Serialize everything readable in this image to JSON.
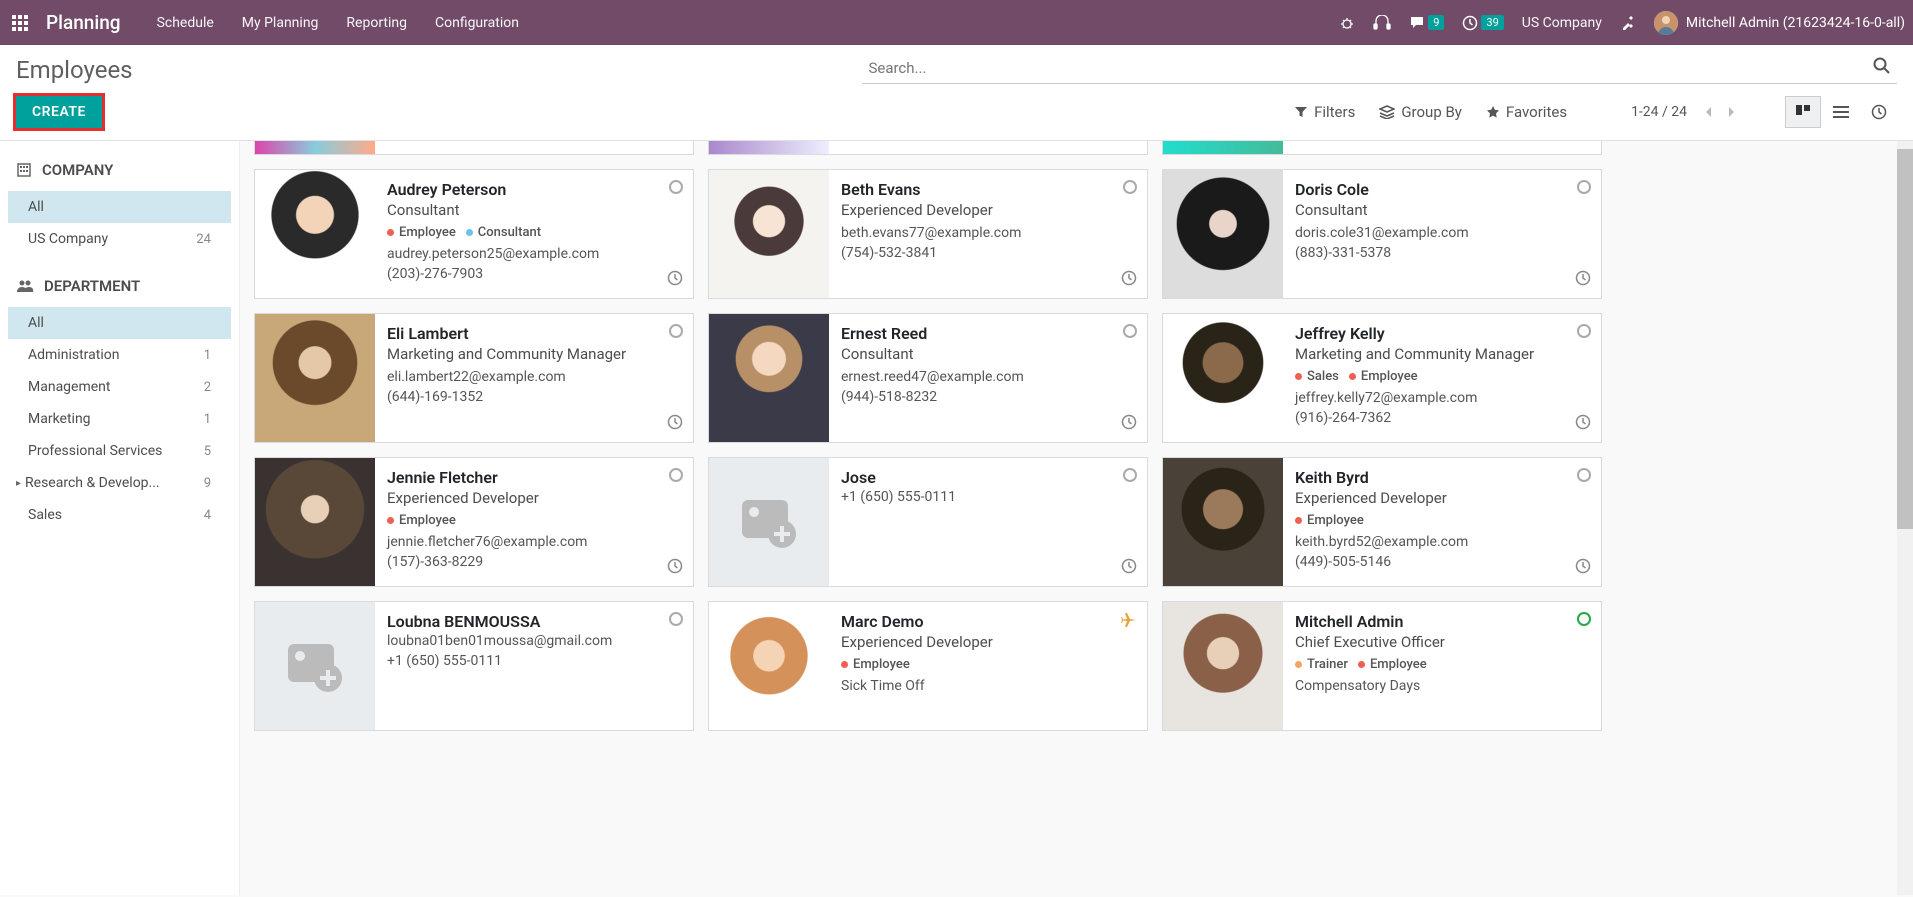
{
  "navbar": {
    "brand": "Planning",
    "menu": [
      "Schedule",
      "My Planning",
      "Reporting",
      "Configuration"
    ],
    "messages_count": "9",
    "activities_count": "39",
    "company": "US Company",
    "user": "Mitchell Admin (21623424-16-0-all)"
  },
  "control": {
    "title": "Employees",
    "create": "CREATE",
    "search_placeholder": "Search...",
    "filters": "Filters",
    "groupby": "Group By",
    "favorites": "Favorites",
    "pager": "1-24 / 24"
  },
  "sidebar": {
    "company_header": "COMPANY",
    "company_items": [
      {
        "label": "All",
        "count": "",
        "selected": true
      },
      {
        "label": "US Company",
        "count": "24"
      }
    ],
    "dept_header": "DEPARTMENT",
    "dept_items": [
      {
        "label": "All",
        "count": "",
        "selected": true
      },
      {
        "label": "Administration",
        "count": "1"
      },
      {
        "label": "Management",
        "count": "2"
      },
      {
        "label": "Marketing",
        "count": "1"
      },
      {
        "label": "Professional Services",
        "count": "5"
      },
      {
        "label": "Research & Develop...",
        "count": "9",
        "arrow": true
      },
      {
        "label": "Sales",
        "count": "4"
      }
    ]
  },
  "cards": [
    [
      {
        "name": "Audrey Peterson",
        "title": "Consultant",
        "tags": [
          {
            "color": "red",
            "label": "Employee"
          },
          {
            "color": "blue",
            "label": "Consultant"
          }
        ],
        "email": "audrey.peterson25@example.com",
        "phone": "(203)-276-7903",
        "img": "ph-audrey",
        "activity": true
      },
      {
        "name": "Beth Evans",
        "title": "Experienced Developer",
        "email": "beth.evans77@example.com",
        "phone": "(754)-532-3841",
        "img": "ph-beth",
        "activity": true
      },
      {
        "name": "Doris Cole",
        "title": "Consultant",
        "email": "doris.cole31@example.com",
        "phone": "(883)-331-5378",
        "img": "ph-doris",
        "activity": true
      }
    ],
    [
      {
        "name": "Eli Lambert",
        "title": "Marketing and Community Manager",
        "email": "eli.lambert22@example.com",
        "phone": "(644)-169-1352",
        "img": "ph-eli",
        "activity": true
      },
      {
        "name": "Ernest Reed",
        "title": "Consultant",
        "email": "ernest.reed47@example.com",
        "phone": "(944)-518-8232",
        "img": "ph-ernest",
        "activity": true
      },
      {
        "name": "Jeffrey Kelly",
        "title": "Marketing and Community Manager",
        "tags": [
          {
            "color": "red",
            "label": "Sales"
          },
          {
            "color": "red",
            "label": "Employee"
          }
        ],
        "email": "jeffrey.kelly72@example.com",
        "phone": "(916)-264-7362",
        "img": "ph-jeffrey",
        "activity": true
      }
    ],
    [
      {
        "name": "Jennie Fletcher",
        "title": "Experienced Developer",
        "tags": [
          {
            "color": "red",
            "label": "Employee"
          }
        ],
        "email": "jennie.fletcher76@example.com",
        "phone": "(157)-363-8229",
        "img": "ph-jennie",
        "activity": true
      },
      {
        "name": "Jose",
        "title": "",
        "email": "",
        "phone": "+1 (650) 555-0111",
        "img": "ph-placeholder",
        "activity": true
      },
      {
        "name": "Keith Byrd",
        "title": "Experienced Developer",
        "tags": [
          {
            "color": "red",
            "label": "Employee"
          }
        ],
        "email": "keith.byrd52@example.com",
        "phone": "(449)-505-5146",
        "img": "ph-keith",
        "activity": true
      }
    ],
    [
      {
        "name": "Loubna BENMOUSSA",
        "title": "",
        "email": "loubna01ben01moussa@gmail.com",
        "phone": "+1 (650) 555-0111",
        "img": "ph-placeholder"
      },
      {
        "name": "Marc Demo",
        "title": "Experienced Developer",
        "tags": [
          {
            "color": "red",
            "label": "Employee"
          }
        ],
        "status": "Sick Time Off",
        "img": "ph-marc",
        "plane": true
      },
      {
        "name": "Mitchell Admin",
        "title": "Chief Executive Officer",
        "tags": [
          {
            "color": "orange",
            "label": "Trainer"
          },
          {
            "color": "red",
            "label": "Employee"
          }
        ],
        "status": "Compensatory Days",
        "img": "ph-mitchell",
        "green": true
      }
    ]
  ]
}
